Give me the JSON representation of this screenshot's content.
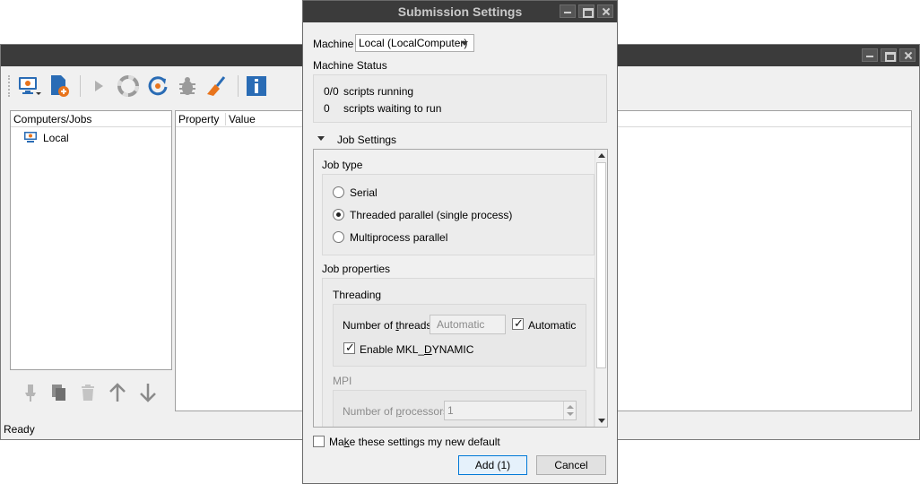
{
  "main": {
    "toolbar": {
      "icons": [
        "computer-icon",
        "add-job-icon",
        "run-icon",
        "help-ring-icon",
        "refresh-icon",
        "debug-icon",
        "clean-icon",
        "info-icon"
      ]
    },
    "tree": {
      "header": "Computers/Jobs",
      "items": [
        {
          "label": "Local",
          "icon": "computer-icon"
        }
      ]
    },
    "properties": {
      "col_property": "Property",
      "col_value": "Value"
    },
    "status": "Ready"
  },
  "dialog": {
    "title": "Submission Settings",
    "machine_label": "Machine",
    "machine_value": "Local (LocalComputer)",
    "machine_status_label": "Machine Status",
    "status_rows": [
      {
        "count": "0/0",
        "text": "scripts running"
      },
      {
        "count": "0",
        "text": "scripts waiting to run"
      }
    ],
    "job_settings_label": "Job Settings",
    "job_type_label": "Job type",
    "job_types": [
      {
        "label": "Serial",
        "checked": false
      },
      {
        "label": "Threaded parallel (single process)",
        "checked": true
      },
      {
        "label": "Multiprocess parallel",
        "checked": false
      }
    ],
    "job_properties_label": "Job properties",
    "threading_label": "Threading",
    "threads_label_pre": "Number of ",
    "threads_label_u": "t",
    "threads_label_post": "hreads",
    "threads_value": "Automatic",
    "automatic_label": "Automatic",
    "automatic_checked": true,
    "mkl_label_pre": "Enable MKL_",
    "mkl_label_u": "D",
    "mkl_label_post": "YNAMIC",
    "mkl_checked": true,
    "mpi_label": "MPI",
    "processors_label_pre": "Number of ",
    "processors_label_u": "p",
    "processors_label_post": "rocessors",
    "processors_value": "1",
    "default_label_pre": "Ma",
    "default_label_u": "k",
    "default_label_post": "e these settings my new default",
    "default_checked": false,
    "add_label": "Add (1)",
    "cancel_label": "Cancel"
  }
}
